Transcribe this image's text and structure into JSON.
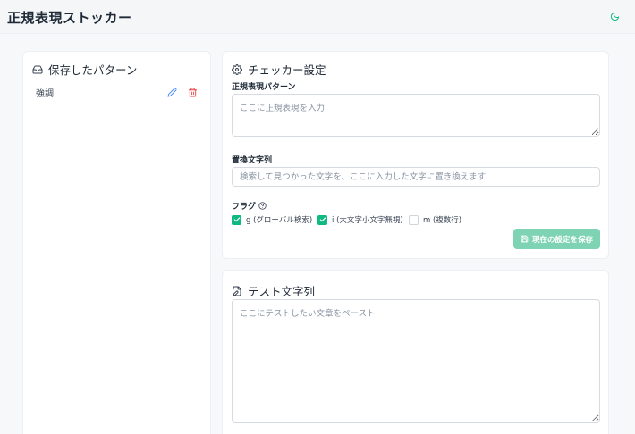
{
  "header": {
    "title": "正規表現ストッカー",
    "theme_icon": "moon-icon"
  },
  "sidebar": {
    "title": "保存したパターン",
    "title_icon": "inbox-icon",
    "patterns": [
      {
        "name": "強調",
        "edit_icon": "pencil-icon",
        "delete_icon": "trash-icon"
      }
    ]
  },
  "settings": {
    "title": "チェッカー設定",
    "title_icon": "gear-icon",
    "regex_label": "正規表現パターン",
    "regex_value": "",
    "regex_placeholder": "ここに正規表現を入力",
    "replace_label": "置換文字列",
    "replace_value": "",
    "replace_placeholder": "検索して見つかった文字を、ここに入力した文字に置き換えます",
    "flags_label": "フラグ",
    "flags_help_icon": "help-circle-icon",
    "flags": [
      {
        "label": "g (グローバル検索)",
        "checked": true
      },
      {
        "label": "i (大文字小文字無視)",
        "checked": true
      },
      {
        "label": "m (複数行)",
        "checked": false
      }
    ],
    "save_label": "現在の設定を保存",
    "save_icon": "save-icon"
  },
  "test": {
    "title": "テスト文字列",
    "title_icon": "edit-file-icon",
    "value": "",
    "placeholder": "ここにテストしたい文章をペースト"
  },
  "colors": {
    "accent": "#10b981",
    "accent_disabled": "#7dd3b4",
    "danger": "#ef4444",
    "edit": "#3b82f6"
  }
}
